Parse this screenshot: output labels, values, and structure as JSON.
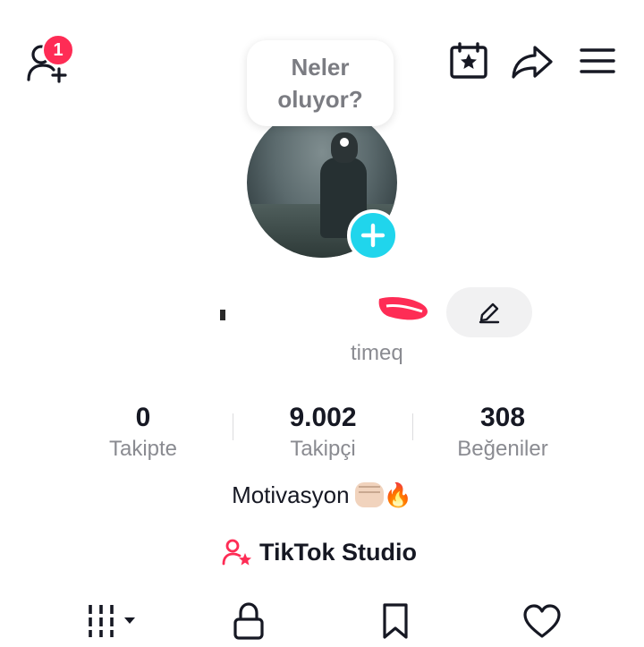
{
  "header": {
    "notification_count": "1",
    "icons": [
      "add-friend-icon",
      "calendar-star-icon",
      "share-icon",
      "menu-icon"
    ]
  },
  "status_bubble": {
    "text": "Neler oluyor?"
  },
  "profile": {
    "username_suffix": "timeq"
  },
  "stats": {
    "following": {
      "value": "0",
      "label": "Takipte"
    },
    "followers": {
      "value": "9.002",
      "label": "Takipçi"
    },
    "likes": {
      "value": "308",
      "label": "Beğeniler"
    }
  },
  "bio": {
    "text": "Motivasyon",
    "emoji": "🔥"
  },
  "studio": {
    "label": "TikTok Studio"
  },
  "tabs": [
    "videos-grid-icon",
    "lock-icon",
    "bookmark-icon",
    "heart-icon"
  ],
  "colors": {
    "accent": "#fe2c55",
    "add_button": "#20d5ec",
    "secondary_text": "#8a8b91"
  }
}
